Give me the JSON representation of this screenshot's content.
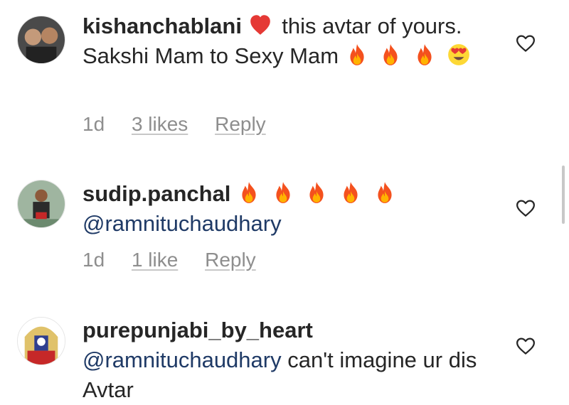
{
  "comments": [
    {
      "username": "kishanchablani",
      "text_before": "this avtar of yours. Sakshi Mam to Sexy Mam",
      "age": "1d",
      "likes": "3 likes",
      "reply": "Reply"
    },
    {
      "username": "sudip.panchal",
      "mention": "@ramnituchaudhary",
      "age": "1d",
      "likes": "1 like",
      "reply": "Reply"
    },
    {
      "username": "purepunjabi_by_heart",
      "mention": "@ramnituchaudhary",
      "text_after": "can't imagine ur dis Avtar"
    }
  ],
  "icons": {
    "like": "heart-outline-icon",
    "heart_emoji": "red-heart-emoji",
    "fire_emoji": "fire-emoji",
    "love_eyes_emoji": "heart-eyes-emoji"
  },
  "colors": {
    "text": "#262626",
    "muted": "#8e8e8e",
    "mention": "#1f3a66"
  }
}
